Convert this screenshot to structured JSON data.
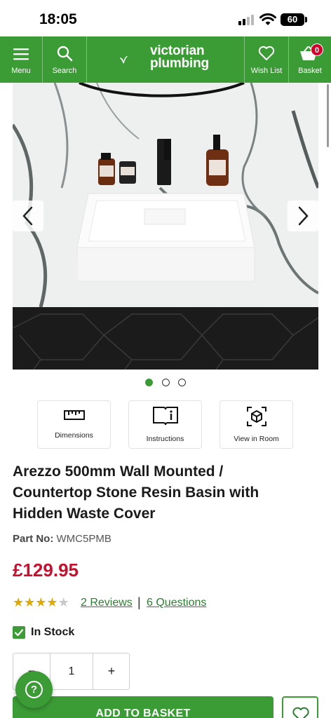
{
  "status_bar": {
    "time": "18:05",
    "battery": "60"
  },
  "header": {
    "menu_label": "Menu",
    "search_label": "Search",
    "brand_line1": "victorian",
    "brand_line2": "plumbing",
    "wishlist_label": "Wish List",
    "basket_label": "Basket",
    "basket_count": "0"
  },
  "gallery": {
    "slide_count": 3,
    "active_slide": 1
  },
  "features": [
    {
      "label": "Dimensions",
      "icon": "ruler-icon"
    },
    {
      "label": "Instructions",
      "icon": "book-info-icon"
    },
    {
      "label": "View in Room",
      "icon": "ar-cube-icon"
    }
  ],
  "product": {
    "title_line1": "Arezzo 500mm Wall Mounted /",
    "title_line2": "Countertop Stone Resin Basin with",
    "title_line3": "Hidden Waste Cover",
    "part_label": "Part No:",
    "part_number": "WMC5PMB",
    "price": "£129.95",
    "rating": 4,
    "rating_max": 5,
    "reviews_link": "2 Reviews",
    "questions_link": "6 Questions",
    "separator": "|",
    "stock_status": "In Stock"
  },
  "purchase": {
    "minus": "−",
    "quantity": "1",
    "plus": "+",
    "add_to_basket": "ADD TO BASKET"
  },
  "help_label": "?",
  "colors": {
    "brand_green": "#3b9b35",
    "price_red": "#c8102e",
    "star": "#e0a800"
  }
}
